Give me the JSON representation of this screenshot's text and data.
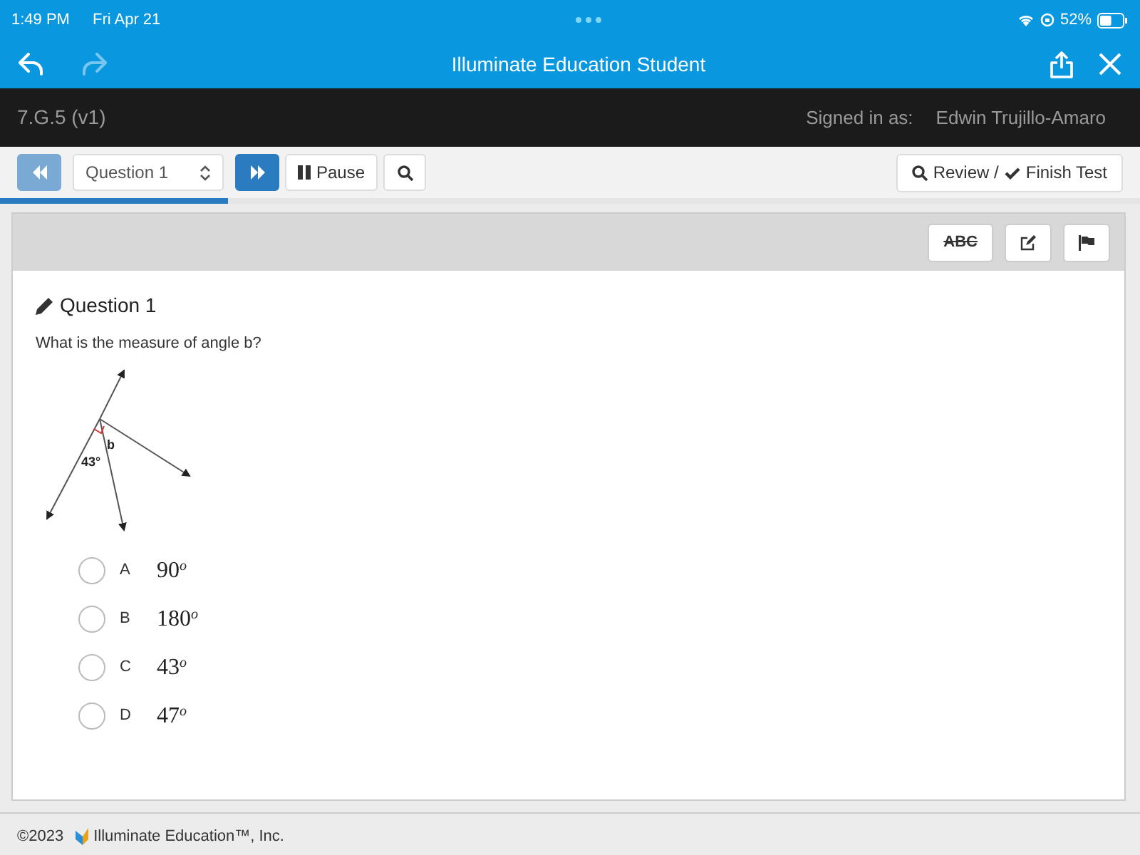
{
  "status_bar": {
    "time": "1:49 PM",
    "date": "Fri Apr 21",
    "battery": "52%"
  },
  "app_bar": {
    "title": "Illuminate Education Student",
    "back_disabled": false,
    "forward_disabled": true
  },
  "test_bar": {
    "test_name": "7.G.5 (v1)",
    "signed_in_label": "Signed in as:",
    "user": "Edwin Trujillo-Amaro"
  },
  "toolbar": {
    "prev_disabled": true,
    "question_select": "Question 1",
    "pause": "Pause",
    "review": "Review /",
    "finish": "Finish Test"
  },
  "progress": {
    "level": 0.2
  },
  "tools": {
    "strike": "ABC"
  },
  "question": {
    "title": "Question 1",
    "prompt": "What is the measure of angle b?",
    "diagram_labels": [
      "b",
      "43°"
    ],
    "choices": [
      {
        "letter": "A",
        "answer": "90$^{o}$",
        "selected": false
      },
      {
        "letter": "B",
        "answer": "180$^{o}$",
        "selected": false
      },
      {
        "letter": "C",
        "answer": "43$^{o}$",
        "selected": false
      },
      {
        "letter": "D",
        "answer": "47$^{o}$",
        "selected": false
      }
    ]
  },
  "footer": {
    "copyright": "©2023",
    "company": "Illuminate Education™, Inc."
  }
}
